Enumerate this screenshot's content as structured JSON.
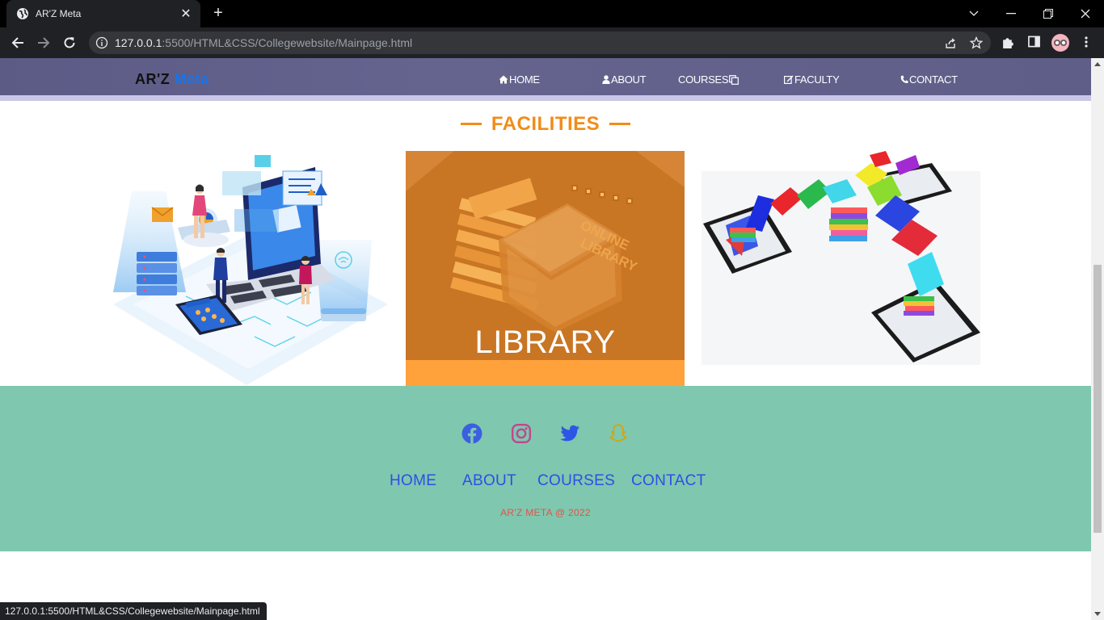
{
  "browser": {
    "tab_title": "AR'Z Meta",
    "url_host": "127.0.0.1",
    "url_rest": ":5500/HTML&CSS/Collegewebsite/Mainpage.html",
    "status_url": "127.0.0.1:5500/HTML&CSS/Collegewebsite/Mainpage.html"
  },
  "site_nav": {
    "logo_part1": "AR'Z",
    "logo_part2": "Meta",
    "links": [
      {
        "label": "HOME",
        "icon": "home-icon"
      },
      {
        "label": "ABOUT",
        "icon": "user-icon"
      },
      {
        "label": "COURSES",
        "icon": "copy-icon"
      },
      {
        "label": "FACULTY",
        "icon": "edit-icon"
      },
      {
        "label": "CONTACT",
        "icon": "phone-icon"
      }
    ]
  },
  "facilities": {
    "title": "FACILITIES",
    "cards": [
      {
        "image": "computer-lab-illustration"
      },
      {
        "image": "online-library-illustration",
        "overlay_text": "ONLINE LIBRARY",
        "caption": "LIBRARY"
      },
      {
        "image": "e-books-tablets-image"
      }
    ]
  },
  "footer": {
    "social": [
      "facebook-icon",
      "instagram-icon",
      "twitter-icon",
      "snapchat-icon"
    ],
    "links": [
      "HOME",
      "ABOUT",
      "COURSES",
      "CONTACT"
    ],
    "copyright": "AR'Z META @ 2022"
  },
  "colors": {
    "nav_bg": "#5e5e88",
    "accent_orange": "#f28c18",
    "library_bg": "#c87524",
    "library_bar": "#ffa23c",
    "footer_bg": "#7fc7af",
    "footer_link": "#2f4ee6",
    "copyright": "#e2544a",
    "logo_blue": "#1a73e8"
  }
}
